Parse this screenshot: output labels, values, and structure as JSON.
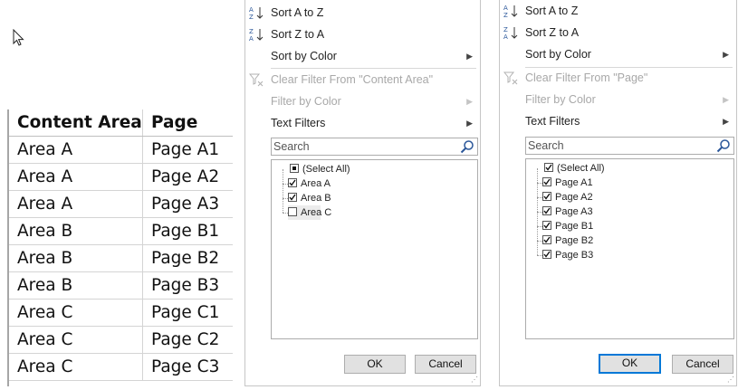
{
  "table": {
    "headers": [
      "Content Area",
      "Page"
    ],
    "rows": [
      [
        "Area A",
        "Page A1"
      ],
      [
        "Area A",
        "Page A2"
      ],
      [
        "Area A",
        "Page A3"
      ],
      [
        "Area B",
        "Page B1"
      ],
      [
        "Area B",
        "Page B2"
      ],
      [
        "Area B",
        "Page B3"
      ],
      [
        "Area C",
        "Page C1"
      ],
      [
        "Area C",
        "Page C2"
      ],
      [
        "Area C",
        "Page C3"
      ]
    ]
  },
  "filter_content_area": {
    "sort_az": "Sort A to Z",
    "sort_za": "Sort Z to A",
    "sort_by_color": "Sort by Color",
    "clear_filter": "Clear Filter From \"Content Area\"",
    "filter_by_color": "Filter by Color",
    "text_filters": "Text Filters",
    "search_placeholder": "Search",
    "items": [
      {
        "label": "(Select All)",
        "state": "partial"
      },
      {
        "label": "Area A",
        "state": "checked"
      },
      {
        "label": "Area B",
        "state": "checked"
      },
      {
        "label": "Area C",
        "state": "unchecked"
      }
    ],
    "ok": "OK",
    "cancel": "Cancel"
  },
  "filter_page": {
    "sort_az": "Sort A to Z",
    "sort_za": "Sort Z to A",
    "sort_by_color": "Sort by Color",
    "clear_filter": "Clear Filter From \"Page\"",
    "filter_by_color": "Filter by Color",
    "text_filters": "Text Filters",
    "search_placeholder": "Search",
    "items": [
      {
        "label": "(Select All)",
        "state": "checked"
      },
      {
        "label": "Page A1",
        "state": "checked"
      },
      {
        "label": "Page A2",
        "state": "checked"
      },
      {
        "label": "Page A3",
        "state": "checked"
      },
      {
        "label": "Page B1",
        "state": "checked"
      },
      {
        "label": "Page B2",
        "state": "checked"
      },
      {
        "label": "Page B3",
        "state": "checked"
      }
    ],
    "ok": "OK",
    "cancel": "Cancel"
  }
}
